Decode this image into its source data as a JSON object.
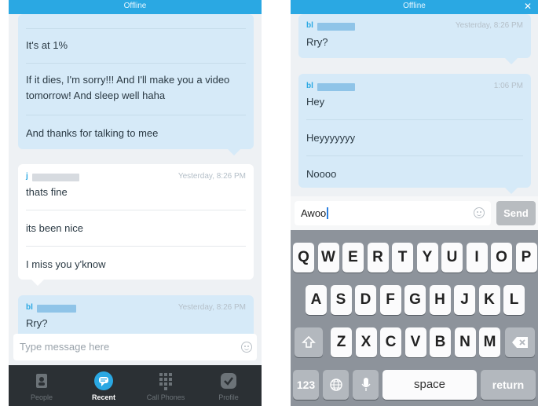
{
  "left_screen": {
    "status_bar": "Offline",
    "my_bubble": {
      "messages": [
        "It's at 1%",
        "If it dies, I'm sorry!!! And I'll make you a video tomorrow! And sleep well haha",
        "And thanks for talking to mee"
      ]
    },
    "their_bubble": {
      "sender_initial": "j",
      "timestamp": "Yesterday, 8:26 PM",
      "messages": [
        "thats fine",
        "its been nice",
        "I miss you y'know"
      ]
    },
    "my_bubble_2": {
      "sender_initial": "bl",
      "timestamp": "Yesterday, 8:26 PM",
      "messages": [
        "Rry?"
      ]
    },
    "composer": {
      "placeholder": "Type message here",
      "emoji_icon": "smiley-icon"
    },
    "tabbar": {
      "tabs": [
        {
          "label": "People",
          "icon": "people-icon"
        },
        {
          "label": "Recent",
          "icon": "chat-bubble-icon",
          "active": true
        },
        {
          "label": "Call Phones",
          "icon": "dialpad-icon"
        },
        {
          "label": "Profile",
          "icon": "checkmark-icon"
        }
      ]
    }
  },
  "right_screen": {
    "status_bar": "Offline",
    "bubble_1": {
      "sender_initial": "bl",
      "timestamp": "Yesterday, 8:26 PM",
      "messages": [
        "Rry?"
      ]
    },
    "bubble_2": {
      "sender_initial": "bl",
      "timestamp": "1:06 PM",
      "messages": [
        "Hey",
        "Heyyyyyyy",
        "Noooo"
      ]
    },
    "composer": {
      "value": "Awoo",
      "send_label": "Send"
    },
    "keyboard": {
      "row1": [
        "Q",
        "W",
        "E",
        "R",
        "T",
        "Y",
        "U",
        "I",
        "O",
        "P"
      ],
      "row2": [
        "A",
        "S",
        "D",
        "F",
        "G",
        "H",
        "J",
        "K",
        "L"
      ],
      "row3": [
        "Z",
        "X",
        "C",
        "V",
        "B",
        "N",
        "M"
      ],
      "numbers_label": "123",
      "space_label": "space",
      "return_label": "return"
    }
  },
  "colors": {
    "accent": "#2aa8e3",
    "my_bubble": "#d6eaf8",
    "their_bubble": "#ffffff",
    "tabbar": "#2b3034",
    "keyboard": "#8d939b"
  }
}
